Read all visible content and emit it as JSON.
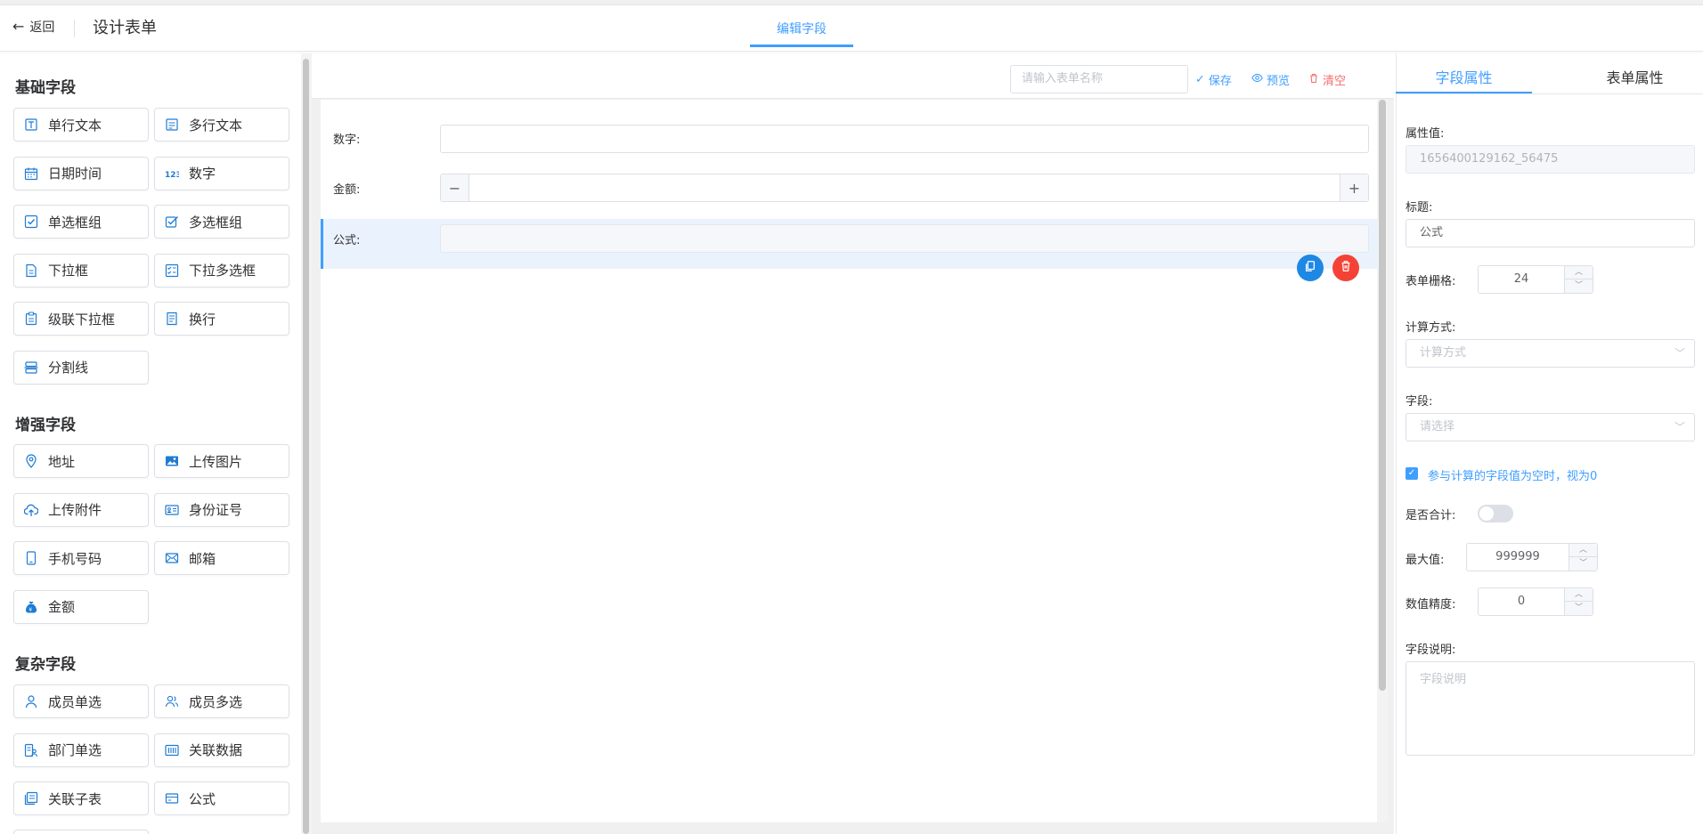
{
  "header": {
    "back_label": "返回",
    "title": "设计表单",
    "tab_label": "编辑字段"
  },
  "palette": {
    "basic_title": "基础字段",
    "basic": [
      {
        "label": "单行文本",
        "icon": "text-input-icon"
      },
      {
        "label": "多行文本",
        "icon": "textarea-icon"
      },
      {
        "label": "日期时间",
        "icon": "calendar-icon"
      },
      {
        "label": "数字",
        "icon": "number-icon"
      },
      {
        "label": "单选框组",
        "icon": "radio-icon"
      },
      {
        "label": "多选框组",
        "icon": "checkbox-group-icon"
      },
      {
        "label": "下拉框",
        "icon": "dropdown-icon"
      },
      {
        "label": "下拉多选框",
        "icon": "multi-select-icon"
      },
      {
        "label": "级联下拉框",
        "icon": "cascader-icon"
      },
      {
        "label": "换行",
        "icon": "line-break-icon"
      },
      {
        "label": "分割线",
        "icon": "divider-icon"
      }
    ],
    "enhanced_title": "增强字段",
    "enhanced": [
      {
        "label": "地址",
        "icon": "location-icon"
      },
      {
        "label": "上传图片",
        "icon": "image-icon"
      },
      {
        "label": "上传附件",
        "icon": "upload-icon"
      },
      {
        "label": "身份证号",
        "icon": "id-card-icon"
      },
      {
        "label": "手机号码",
        "icon": "phone-icon"
      },
      {
        "label": "邮箱",
        "icon": "mail-icon"
      },
      {
        "label": "金额",
        "icon": "money-bag-icon"
      }
    ],
    "complex_title": "复杂字段",
    "complex": [
      {
        "label": "成员单选",
        "icon": "user-icon"
      },
      {
        "label": "成员多选",
        "icon": "users-icon"
      },
      {
        "label": "部门单选",
        "icon": "department-icon"
      },
      {
        "label": "关联数据",
        "icon": "linked-data-icon"
      },
      {
        "label": "关联子表",
        "icon": "subtable-icon"
      },
      {
        "label": "公式",
        "icon": "formula-icon"
      }
    ]
  },
  "toolbar": {
    "form_name_placeholder": "请输入表单名称",
    "save": "保存",
    "preview": "预览",
    "clear": "清空"
  },
  "canvas": {
    "fields": [
      {
        "label": "数字:"
      },
      {
        "label": "金额:"
      },
      {
        "label": "公式:"
      }
    ],
    "minus": "−",
    "plus": "+"
  },
  "props": {
    "tab_field": "字段属性",
    "tab_form": "表单属性",
    "attr_value_label": "属性值:",
    "attr_value": "1656400129162_56475",
    "title_label": "标题:",
    "title_value": "公式",
    "grid_label": "表单栅格:",
    "grid_value": "24",
    "calc_label": "计算方式:",
    "calc_placeholder": "计算方式",
    "field_label": "字段:",
    "field_placeholder": "请选择",
    "empty_as_zero": "参与计算的字段值为空时，视为0",
    "sum_label": "是否合计:",
    "max_label": "最大值:",
    "max_value": "999999",
    "precision_label": "数值精度:",
    "precision_value": "0",
    "desc_label": "字段说明:",
    "desc_placeholder": "字段说明"
  },
  "colors": {
    "accent": "#409eff",
    "danger": "#f56c6c"
  }
}
